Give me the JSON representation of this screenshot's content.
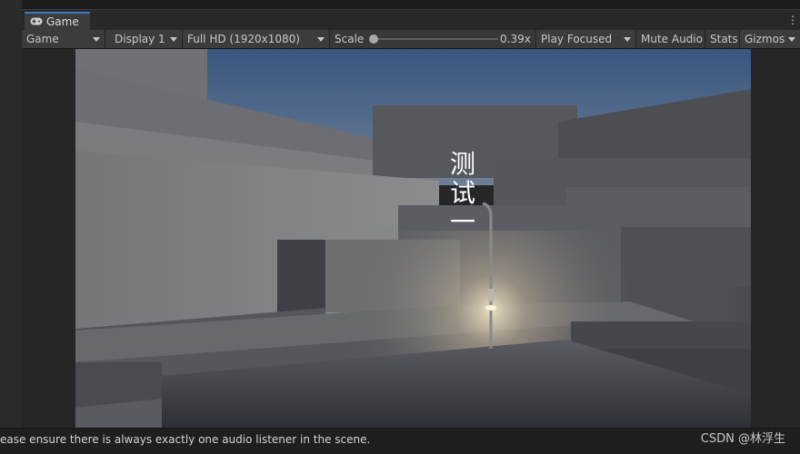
{
  "tab": {
    "label": "Game",
    "icon": "gamepad-icon"
  },
  "more_menu": "⋮",
  "toolbar": {
    "view_mode": "Game",
    "display": "Display 1",
    "resolution": "Full HD (1920x1080)",
    "scale_label": "Scale",
    "scale_value": "0.39x",
    "scale_level": 0.39,
    "play_mode": "Play Focused",
    "mute_audio": "Mute Audio",
    "stats": "Stats",
    "gizmos": "Gizmos"
  },
  "game_view": {
    "overlay_text": [
      "测",
      "试",
      "一"
    ]
  },
  "status_bar": {
    "message": "ease ensure there is always exactly one audio listener in the scene.",
    "watermark": "CSDN @林浮生"
  },
  "colors": {
    "tab_accent": "#3a79bb",
    "sky_top": "#38567f",
    "sky_bottom": "#6e7f97"
  }
}
